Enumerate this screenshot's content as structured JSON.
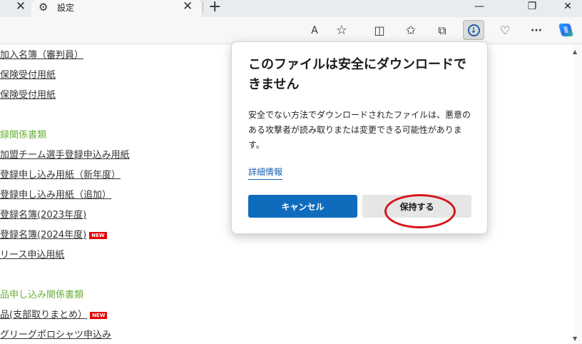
{
  "tabs": {
    "left_close": "✕",
    "active_icon": "⚙",
    "active_title": "設定",
    "active_close": "✕",
    "new_tab": "+"
  },
  "window_controls": {
    "minimize": "—",
    "restore": "❐",
    "close": "✕"
  },
  "toolbar": {
    "read_aloud": "A",
    "favorite": "☆",
    "split_screen": "◫",
    "favorites": "✩",
    "collections": "⧉",
    "download": "↓",
    "health": "♡",
    "more": "···"
  },
  "page": {
    "links": [
      "加入名簿（審判員）",
      "保険受付用紙",
      "保険受付用紙"
    ],
    "heading_1": "録関係書類",
    "links_2": [
      "加盟チーム選手登録申込み用紙",
      "登録申し込み用紙（新年度）",
      "登録申し込み用紙（追加）",
      "登録名簿(2023年度)",
      "登録名簿(2024年度)",
      "リース申込用紙"
    ],
    "heading_2": "品申し込み関係書類",
    "links_3": [
      "品(支部取りまとめ）",
      "グリーグポロシャツ申込み"
    ],
    "new_badge": "NEW"
  },
  "dialog": {
    "title": "このファイルは安全にダウンロードできません",
    "body": "安全でない方法でダウンロードされたファイルは、悪意のある攻撃者が読み取りまたは変更できる可能性があります。",
    "details_link": "詳細情報",
    "cancel_label": "キャンセル",
    "keep_label": "保持する"
  },
  "colors": {
    "primary_button": "#0f6cbd",
    "link": "#1a5fb4",
    "heading_green": "#6ab03b",
    "annotation_red": "#d7141a"
  }
}
